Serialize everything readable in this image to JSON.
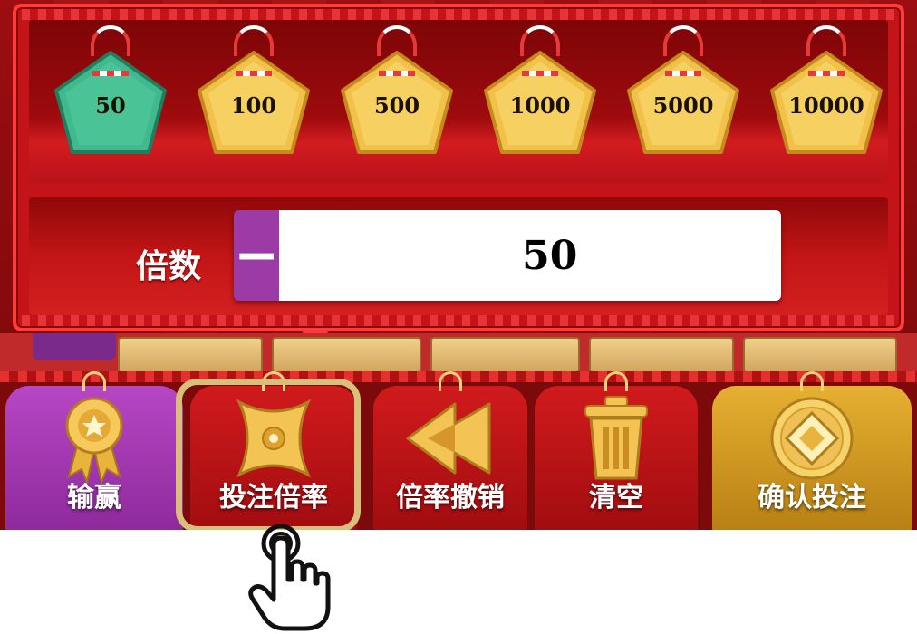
{
  "chips": [
    {
      "value": "50",
      "selected": true
    },
    {
      "value": "100",
      "selected": false
    },
    {
      "value": "500",
      "selected": false
    },
    {
      "value": "1000",
      "selected": false
    },
    {
      "value": "5000",
      "selected": false
    },
    {
      "value": "10000",
      "selected": false
    }
  ],
  "multiplier": {
    "label": "倍数",
    "value": "50",
    "minus": "−",
    "plus": "+"
  },
  "bottom_bar": {
    "win_lose": "输赢",
    "bet_multiplier": "投注倍率",
    "undo_multiplier": "倍率撤销",
    "clear": "清空",
    "confirm_bet": "确认投注"
  },
  "colors": {
    "chip_selected": "#3fb98d",
    "chip_default": "#f1c14a",
    "stepper_button": "#9c3ba6",
    "highlight_border": "#d8c07a"
  },
  "icons": {
    "win_lose": "medal-icon",
    "bet_multiplier": "shuriken-icon",
    "undo_multiplier": "rewind-icon",
    "clear": "trash-icon",
    "confirm_bet": "coin-icon",
    "pointer": "tap-hand-icon"
  }
}
